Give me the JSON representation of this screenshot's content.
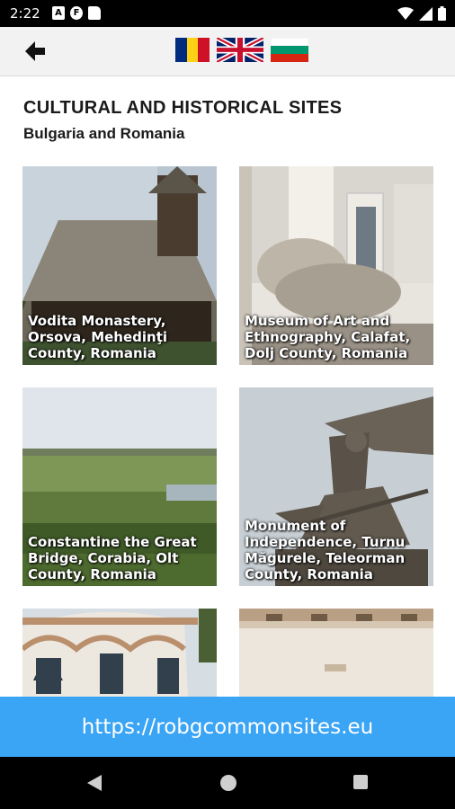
{
  "status_bar": {
    "time": "2:22",
    "left_icons": [
      "A",
      "F",
      "sd-card-icon"
    ],
    "right_icons": [
      "wifi-icon",
      "signal-icon",
      "battery-icon"
    ]
  },
  "app_bar": {
    "back_icon": "arrow-left-icon",
    "languages": [
      {
        "name": "Romanian",
        "flag": "romania-flag-icon"
      },
      {
        "name": "English",
        "flag": "uk-flag-icon"
      },
      {
        "name": "Bulgarian",
        "flag": "bulgaria-flag-icon"
      }
    ]
  },
  "page": {
    "title": "CULTURAL AND HISTORICAL SITES",
    "subtitle": "Bulgaria and Romania"
  },
  "sites": [
    {
      "label": "Vodita Monastery, Orsova, Mehedinţi County, Romania"
    },
    {
      "label": "Museum of Art and Ethnography, Calafat, Dolj County, Romania"
    },
    {
      "label": "Constantine the Great Bridge, Corabia, Olt County, Romania"
    },
    {
      "label": "Monument of Independence, Turnu Măgurele, Teleorman County, Romania"
    },
    {
      "label": ""
    },
    {
      "label": ""
    }
  ],
  "footer": {
    "link": "https://robgcommonsites.eu",
    "color": "#3aa4f5"
  },
  "nav_bar": {
    "icons": [
      "back-triangle-icon",
      "home-circle-icon",
      "recents-square-icon"
    ]
  }
}
